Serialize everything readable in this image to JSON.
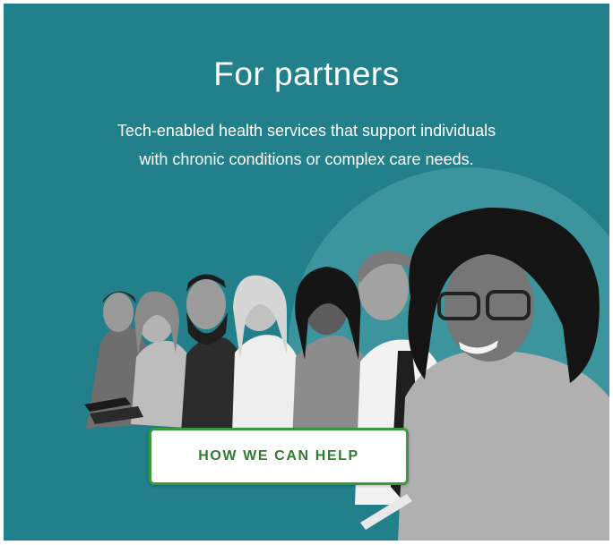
{
  "hero": {
    "title": "For partners",
    "subtitle_line1": "Tech-enabled health services that support individuals",
    "subtitle_line2": "with chronic conditions or complex care needs.",
    "cta_label": "HOW WE CAN HELP"
  },
  "colors": {
    "panel_background": "#22808a",
    "circle_accent": "#3c949c",
    "button_border": "#3a9a3a",
    "button_text": "#2f7d2f"
  },
  "image": {
    "subject": "group-of-smiling-people-in-a-row"
  }
}
